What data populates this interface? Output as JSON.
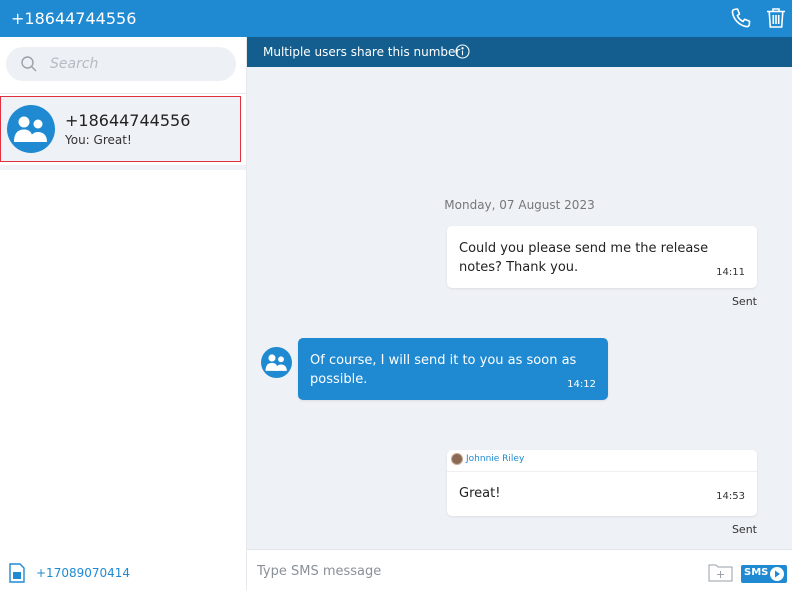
{
  "header": {
    "title": "+18644744556",
    "phone_icon": "phone-icon",
    "trash_icon": "trash-icon"
  },
  "sidebar": {
    "search": {
      "placeholder": "Search"
    },
    "conversations": [
      {
        "name": "+18644744556",
        "preview": "You: Great!",
        "selected": true
      }
    ],
    "own_number": "+17089070414"
  },
  "chat": {
    "banner": "Multiple users share this number",
    "date_separator": "Monday, 07 August 2023",
    "messages": [
      {
        "direction": "out",
        "text": "Could you please send me the release notes? Thank you.",
        "time": "14:11",
        "status": "Sent"
      },
      {
        "direction": "in",
        "text": "Of course, I will send it to you as soon as possible.",
        "time": "14:12"
      },
      {
        "direction": "out",
        "sender": "Johnnie Riley",
        "text": "Great!",
        "time": "14:53",
        "status": "Sent"
      }
    ],
    "composer": {
      "placeholder": "Type SMS message",
      "send_label": "SMS"
    }
  },
  "colors": {
    "accent": "#1f8ad2",
    "banner": "#135e8e",
    "chat_background": "#eef1f6",
    "selection_border": "#e0303f"
  }
}
